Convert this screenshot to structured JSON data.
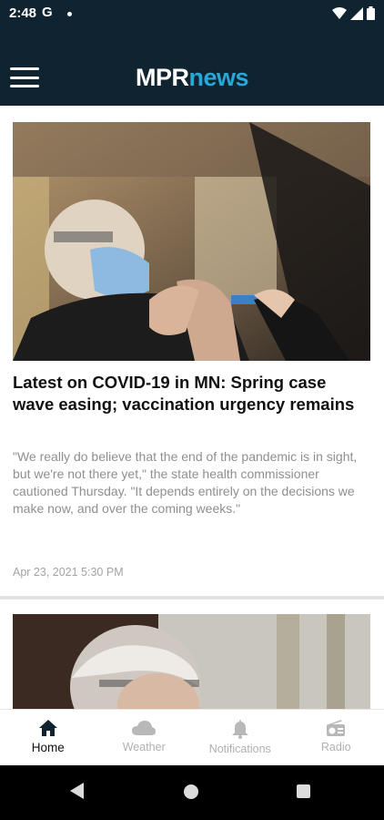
{
  "status_bar": {
    "time": "2:48",
    "g_icon": "G"
  },
  "app_bar": {
    "logo_mpr": "MPR",
    "logo_news": "news"
  },
  "articles": [
    {
      "headline": "Latest on COVID-19 in MN: Spring case wave easing; vaccination urgency remains",
      "summary": "\"We really do believe that the end of the pandemic is in sight, but we're not there yet,\" the state health commissioner cautioned Thursday. \"It depends entirely on the decisions we make now, and over the coming weeks.\"",
      "date": "Apr 23, 2021 5:30 PM"
    }
  ],
  "bottom_nav": {
    "items": [
      {
        "label": "Home",
        "icon": "home-icon",
        "active": true
      },
      {
        "label": "Weather",
        "icon": "cloud-icon",
        "active": false
      },
      {
        "label": "Notifications",
        "icon": "bell-icon",
        "active": false
      },
      {
        "label": "Radio",
        "icon": "radio-icon",
        "active": false
      }
    ]
  },
  "colors": {
    "header_bg": "#0f2430",
    "brand_accent": "#27a8d6",
    "muted_text": "#8f8f8f"
  }
}
